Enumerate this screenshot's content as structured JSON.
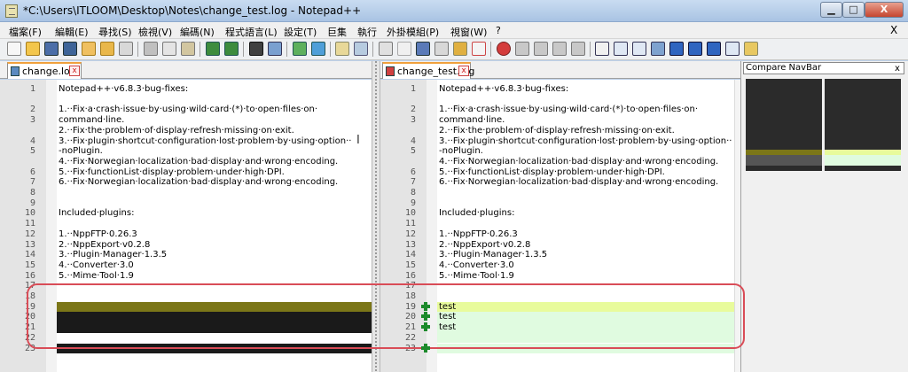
{
  "window": {
    "title": "*C:\\Users\\ITLOOM\\Desktop\\Notes\\change_test.log - Notepad++",
    "min_symbol": "▁",
    "max_symbol": "□",
    "close_symbol": "X"
  },
  "menu": {
    "items": [
      "檔案(F)",
      "編輯(E)",
      "尋找(S)",
      "檢視(V)",
      "編碼(N)",
      "程式語言(L)",
      "設定(T)",
      "巨集",
      "執行",
      "外掛模組(P)",
      "視窗(W)",
      "?"
    ],
    "close_symbol": "X"
  },
  "tabs": {
    "left": {
      "label": "change.log"
    },
    "right": {
      "label": "change_test.log"
    },
    "close_symbol": "x"
  },
  "editor": {
    "lines": [
      "Notepad++·v6.8.3·bug-fixes:",
      "",
      "1.··Fix·a·crash·issue·by·using·wild·card·(*)·to·open·files·on·",
      "command·line.",
      "2.··Fix·the·problem·of·display·refresh·missing·on·exit.",
      "3.··Fix·plugin·shortcut·configuration·lost·problem·by·using·option··",
      "-noPlugin.",
      "4.··Fix·Norwegian·localization·bad·display·and·wrong·encoding.",
      "5.··Fix·functionList·display·problem·under·high·DPI.",
      "6.··Fix·Norwegian·localization·bad·display·and·wrong·encoding.",
      "",
      "",
      "Included·plugins:",
      "",
      "1.··NppFTP·0.26.3",
      "2.··NppExport·v0.2.8",
      "3.··Plugin·Manager·1.3.5",
      "4.··Converter·3.0",
      "5.··Mime·Tool·1.9",
      "",
      "",
      "",
      "",
      "",
      ""
    ],
    "line_numbers": [
      "1",
      "",
      "2",
      "3",
      "",
      "4",
      "5",
      "",
      "6",
      "7",
      "8",
      "9",
      "10",
      "11",
      "12",
      "13",
      "14",
      "15",
      "16",
      "17",
      "18",
      "19",
      "20",
      "21",
      "22",
      "23"
    ],
    "left_tail": [
      "",
      "",
      "",
      "",
      ""
    ],
    "right_tail": [
      "test",
      "test",
      "test",
      "",
      ""
    ]
  },
  "navbar": {
    "title": "Compare NavBar",
    "close_symbol": "x"
  },
  "colors": {
    "changed_bg": "#7b7618",
    "removed_bg": "#1a1a1a",
    "added_bg": "#e0fbe0",
    "added_first_bg": "#e8fb9c",
    "accent_tab": "#f0a03c",
    "annotation": "#d94c57"
  }
}
